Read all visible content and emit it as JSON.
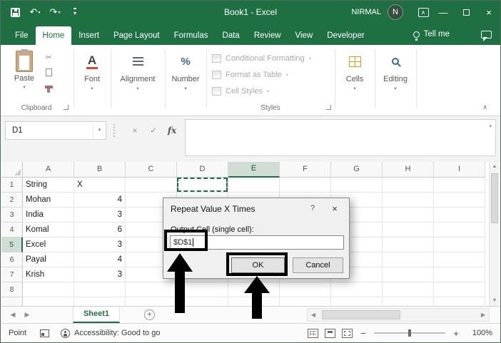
{
  "colors": {
    "excel_green": "#1e7043",
    "header_selection": "#d0ddd5",
    "annotation_black": "#000000",
    "dialog_bg": "#f0f0f0"
  },
  "titlebar": {
    "title": "Book1 - Excel",
    "user_name": "NIRMAL",
    "avatar_initial": "N"
  },
  "ribbon_tabs": {
    "items": [
      "File",
      "Home",
      "Insert",
      "Page Layout",
      "Formulas",
      "Data",
      "Review",
      "View",
      "Developer"
    ],
    "active": "Home",
    "tell_me": "Tell me"
  },
  "ribbon": {
    "paste_label": "Paste",
    "clipboard_group_label": "Clipboard",
    "font_label": "Font",
    "alignment_label": "Alignment",
    "number_label": "Number",
    "styles_buttons": [
      "Conditional Formatting",
      "Format as Table",
      "Cell Styles"
    ],
    "styles_group_label": "Styles",
    "cells_label": "Cells",
    "editing_label": "Editing"
  },
  "formula_bar": {
    "name_box_value": "D1",
    "fx_label": "fx"
  },
  "grid": {
    "column_headers": [
      "A",
      "B",
      "C",
      "D",
      "E",
      "F",
      "G",
      "H",
      "I"
    ],
    "selected_column": "E",
    "selected_row": "5",
    "copy_source_cell": "D1",
    "rows": [
      {
        "n": "1",
        "A": "String",
        "B": "X"
      },
      {
        "n": "2",
        "A": "Mohan",
        "B": "4"
      },
      {
        "n": "3",
        "A": "India",
        "B": "3"
      },
      {
        "n": "4",
        "A": "Komal",
        "B": "6"
      },
      {
        "n": "5",
        "A": "Excel",
        "B": "3"
      },
      {
        "n": "6",
        "A": "Payal",
        "B": "4"
      },
      {
        "n": "7",
        "A": "Krish",
        "B": "3"
      },
      {
        "n": "8",
        "A": "",
        "B": ""
      }
    ]
  },
  "dialog": {
    "title": "Repeat Value X Times",
    "help_button": "?",
    "close_button": "×",
    "field_label": "Output Cell (single cell):",
    "field_value": "$D$1",
    "ok_label": "OK",
    "cancel_label": "Cancel"
  },
  "sheet_bar": {
    "sheet_name": "Sheet1"
  },
  "status_bar": {
    "mode": "Point",
    "accessibility_text": "Accessibility: Good to go",
    "zoom_level": "100%"
  },
  "icons": {
    "undo": "↶",
    "redo": "↷",
    "dropdown": "▾",
    "minimize": "—",
    "close": "×",
    "formula_cancel": "×",
    "formula_enter": "✓",
    "cut": "✂",
    "font_a": "A",
    "percent": "%",
    "collapse_ribbon": "∧",
    "scroll_up": "▲",
    "scroll_down": "▼",
    "scroll_left": "◀",
    "scroll_right": "▶",
    "add_sheet": "+",
    "zoom_out": "−",
    "zoom_in": "+"
  }
}
